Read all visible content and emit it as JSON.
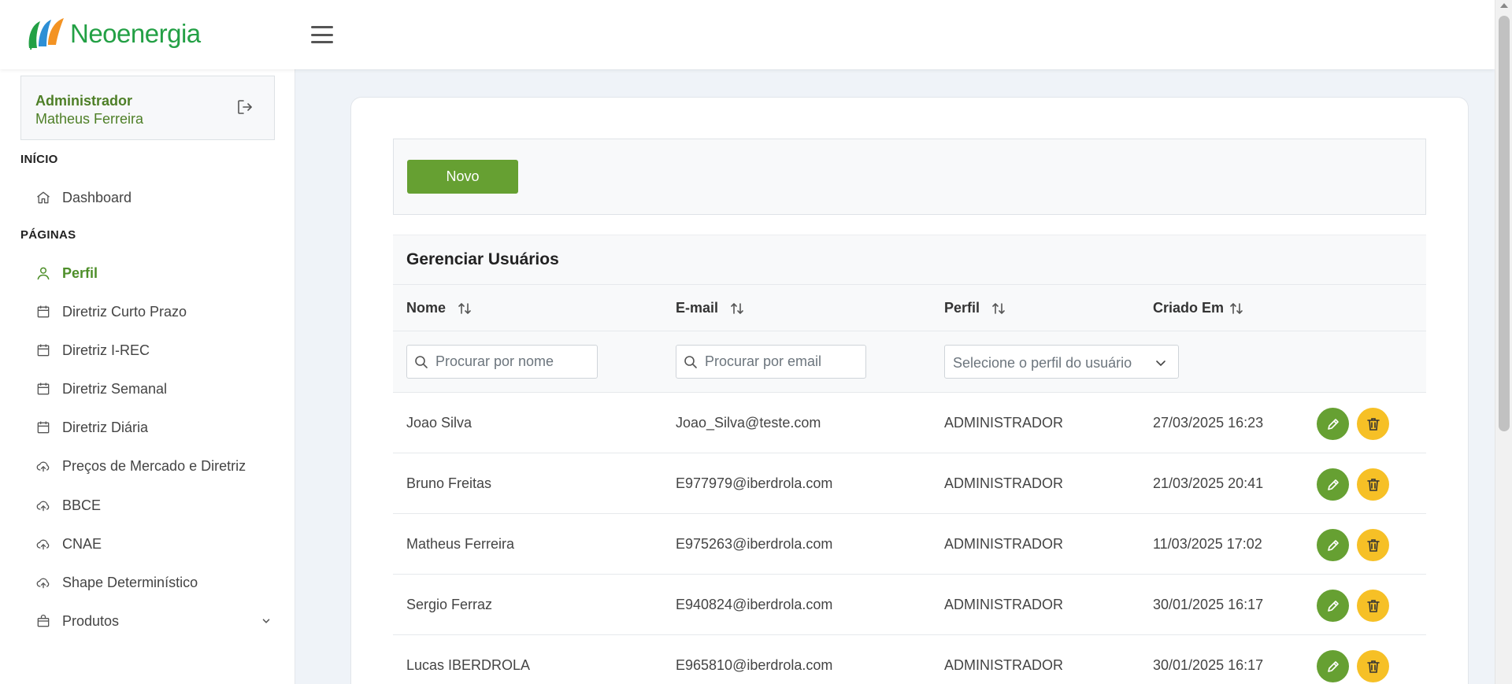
{
  "brand": {
    "name": "Neoenergia",
    "green": "#23a045",
    "orange": "#f39323",
    "blue": "#2d8fd5"
  },
  "colors": {
    "accent": "#66a032",
    "active_text": "#4e8f2a",
    "delete": "#f6c026"
  },
  "user": {
    "role": "Administrador",
    "name": "Matheus Ferreira"
  },
  "sidebar": {
    "section_inicio": "INÍCIO",
    "section_paginas": "PÁGINAS",
    "items": [
      {
        "label": "Dashboard",
        "icon": "home-icon"
      },
      {
        "label": "Perfil",
        "icon": "user-icon",
        "active": true
      },
      {
        "label": "Diretriz Curto Prazo",
        "icon": "calendar-icon"
      },
      {
        "label": "Diretriz I-REC",
        "icon": "calendar-icon"
      },
      {
        "label": "Diretriz Semanal",
        "icon": "calendar-icon"
      },
      {
        "label": "Diretriz Diária",
        "icon": "calendar-icon"
      },
      {
        "label": "Preços de Mercado e Diretriz",
        "icon": "cloud-upload-icon"
      },
      {
        "label": "BBCE",
        "icon": "cloud-upload-icon"
      },
      {
        "label": "CNAE",
        "icon": "cloud-upload-icon"
      },
      {
        "label": "Shape Determinístico",
        "icon": "cloud-upload-icon"
      },
      {
        "label": "Produtos",
        "icon": "shopping-bag-icon"
      }
    ]
  },
  "toolbar": {
    "new_label": "Novo"
  },
  "table": {
    "title": "Gerenciar Usuários",
    "columns": [
      "Nome",
      "E-mail",
      "Perfil",
      "Criado Em"
    ],
    "filters": {
      "name_placeholder": "Procurar por nome",
      "email_placeholder": "Procurar por email",
      "profile_placeholder": "Selecione o perfil do usuário"
    },
    "rows": [
      {
        "name": "Joao Silva",
        "email": "Joao_Silva@teste.com",
        "profile": "ADMINISTRADOR",
        "created": "27/03/2025 16:23"
      },
      {
        "name": "Bruno Freitas",
        "email": "E977979@iberdrola.com",
        "profile": "ADMINISTRADOR",
        "created": "21/03/2025 20:41"
      },
      {
        "name": "Matheus Ferreira",
        "email": "E975263@iberdrola.com",
        "profile": "ADMINISTRADOR",
        "created": "11/03/2025 17:02"
      },
      {
        "name": "Sergio Ferraz",
        "email": "E940824@iberdrola.com",
        "profile": "ADMINISTRADOR",
        "created": "30/01/2025 16:17"
      },
      {
        "name": "Lucas IBERDROLA",
        "email": "E965810@iberdrola.com",
        "profile": "ADMINISTRADOR",
        "created": "30/01/2025 16:17"
      }
    ]
  }
}
